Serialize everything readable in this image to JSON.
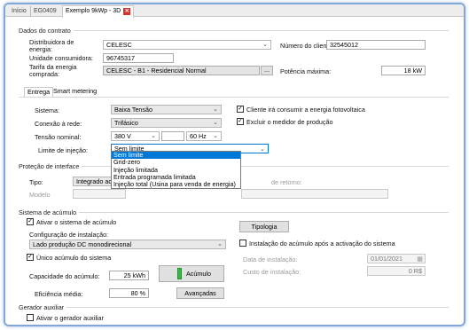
{
  "tabs": [
    "Início",
    "EG0409",
    "Exemplo 9kWp - 3D"
  ],
  "contract": {
    "title": "Dados do contrato",
    "distributor_label": "Distribuidora de energia:",
    "distributor_value": "CELESC",
    "consumer_unit_label": "Unidade consumidora:",
    "consumer_unit_value": "96745317",
    "tariff_label": "Tarifa da energia comprada:",
    "tariff_value": "CELESC - B1 - Residencial Normal",
    "tariff_button": "...",
    "client_number_label": "Número do cliente:",
    "client_number_value": "32545012",
    "max_power_label": "Potência máxima:",
    "max_power_value": "18 kW"
  },
  "subtabs": [
    "Entrega",
    "Smart metering"
  ],
  "delivery": {
    "system_label": "Sistema:",
    "system_value": "Baixa Tensão",
    "grid_connection_label": "Conexão à rede:",
    "grid_connection_value": "Trifásico",
    "voltage_label": "Tensão nominal:",
    "voltage_value": "380 V",
    "freq_value": "60 Hz",
    "injection_limit_label": "Limite de injeção:",
    "injection_limit_value": "Sem limite",
    "injection_options": [
      "Sem limite",
      "Grid-zero",
      "Injeção limitada",
      "Entrada programada limitada",
      "Injeção total (Usina para venda de energia)"
    ],
    "pv_consumer_label": "Cliente irá consumir a energia fotovoltaica",
    "remove_meter_label": "Excluir o medidor de produção"
  },
  "protection": {
    "title": "Proteção de interface",
    "type_label": "Tipo:",
    "type_value": "Integrado ao",
    "model_label": "Modelo",
    "partial_label": "de retorno:"
  },
  "storage": {
    "title": "Sistema de acúmulo",
    "activate_label": "Ativar o sistema de acúmulo",
    "config_label": "Configuração de instalação:",
    "config_value": "Lado produção DC monodirecional",
    "single_label": "Único acúmulo do sistema",
    "capacity_label": "Capacidade do acúmulo:",
    "capacity_value": "25 kWh",
    "accumulo_button": "Acúmulo",
    "efficiency_label": "Eficiência média:",
    "efficiency_value": "80 %",
    "advanced_button": "Avançadas",
    "typology_button": "Tipologia",
    "after_install_label": "Instalação do acúmulo após a activação do sistema",
    "install_date_label": "Data de instalação:",
    "install_date_value": "01/01/2021",
    "install_cost_label": "Custo de instalação:",
    "install_cost_value": "0 R$"
  },
  "aux": {
    "title": "Gerador auxiliar",
    "activate_label": "Ativar o gerador auxiliar"
  },
  "colors": {
    "accent": "#0078d7",
    "frame": "#7fa8d8",
    "close": "#d9342b",
    "battery": "#3bb54a"
  }
}
